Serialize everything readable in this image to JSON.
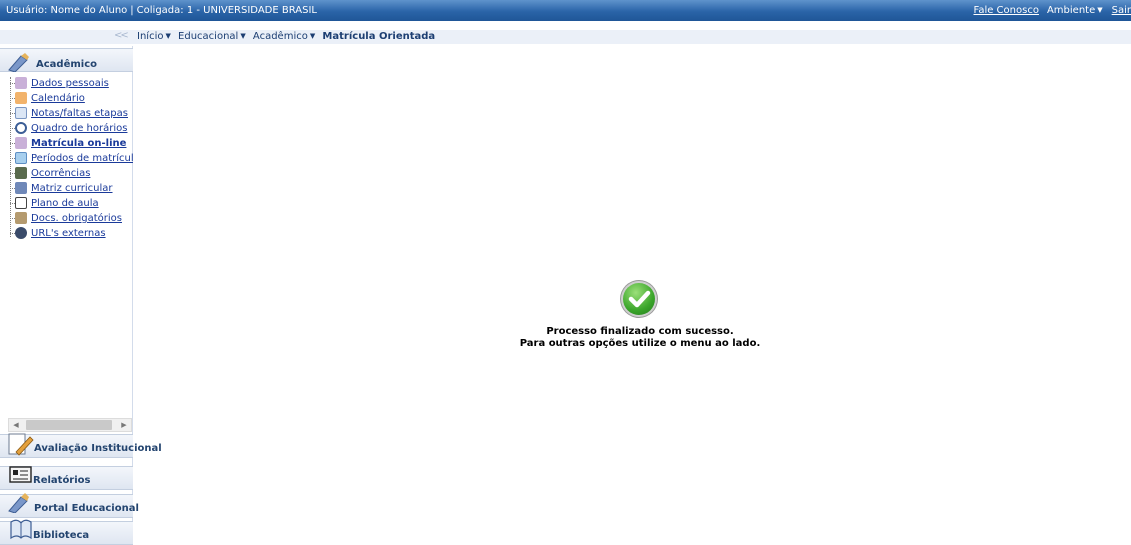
{
  "topbar": {
    "user": "Usuário: Nome do Aluno",
    "separator": "|",
    "coligada": "Coligada: 1 - UNIVERSIDADE BRASIL",
    "contact_link": "Fale Conosco",
    "environment_menu": "Ambiente",
    "exit_link": "Sair"
  },
  "breadcrumb": {
    "collapse_glyph": "<<",
    "items": [
      "Início",
      "Educacional",
      "Acadêmico"
    ],
    "current": "Matrícula Orientada"
  },
  "sidebar": {
    "active_section": "Acadêmico",
    "items": [
      {
        "label": "Dados pessoais",
        "icon": "person-icon"
      },
      {
        "label": "Calendário",
        "icon": "calendar-icon"
      },
      {
        "label": "Notas/faltas etapas",
        "icon": "grades-table-icon"
      },
      {
        "label": "Quadro de horários",
        "icon": "clock-icon"
      },
      {
        "label": "Matrícula on-line",
        "icon": "enrollment-icon"
      },
      {
        "label": "Períodos de matrícula",
        "icon": "period-calendar-icon"
      },
      {
        "label": "Ocorrências",
        "icon": "occurrence-pen-icon"
      },
      {
        "label": "Matriz curricular",
        "icon": "curriculum-pencil-icon"
      },
      {
        "label": "Plano de aula",
        "icon": "book-icon"
      },
      {
        "label": "Docs. obrigatórios",
        "icon": "documents-icon"
      },
      {
        "label": "URL's externas",
        "icon": "globe-icon"
      }
    ],
    "sections": [
      {
        "label": "Avaliação Institucional",
        "icon": "evaluation-icon"
      },
      {
        "label": "Relatórios",
        "icon": "reports-icon"
      },
      {
        "label": "Portal Educacional",
        "icon": "portal-icon"
      },
      {
        "label": "Biblioteca",
        "icon": "library-icon"
      }
    ]
  },
  "message": {
    "line1": "Processo finalizado com sucesso.",
    "line2": "Para outras opções utilize o menu ao lado.",
    "icon": "success-check-icon"
  },
  "colors": {
    "topbar": "#2a64a8",
    "link": "#1a3a9a",
    "success": "#3aa52a"
  }
}
